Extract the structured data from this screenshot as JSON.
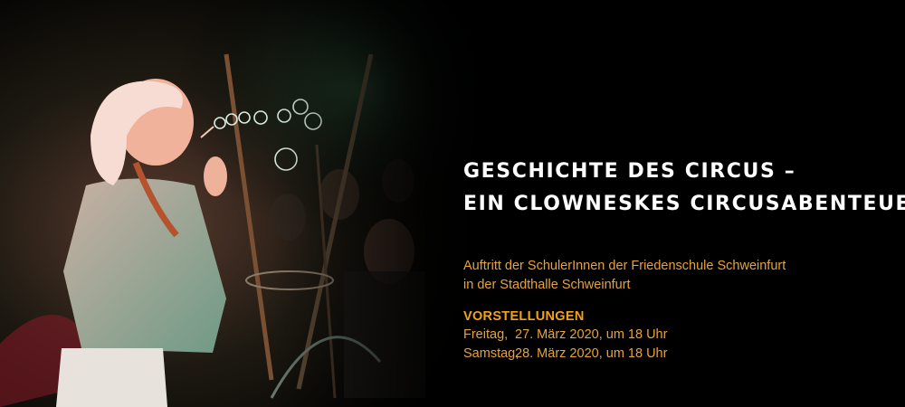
{
  "title": {
    "line1": "GESCHICHTE DES CIRCUS –",
    "line2": "EIN CLOWNESKES CIRCUSABENTEUER"
  },
  "intro": {
    "line1": "Auftritt der SchulerInnen der Friedenschule Schweinfurt",
    "line2": "in der Stadthalle Schweinfurt"
  },
  "shows": {
    "heading": "VORSTELLUNGEN",
    "items": [
      {
        "day": "Freitag,",
        "date": "27. März 2020, um 18 Uhr"
      },
      {
        "day": "Samstag,",
        "date": "28. März 2020, um 18 Uhr"
      }
    ]
  },
  "colors": {
    "background": "#000000",
    "title": "#ffffff",
    "accent": "#e8a33a"
  }
}
